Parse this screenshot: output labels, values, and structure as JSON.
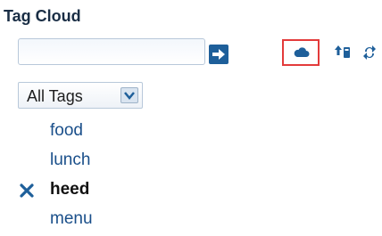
{
  "header": {
    "title": "Tag Cloud"
  },
  "search": {
    "value": "",
    "placeholder": ""
  },
  "toolbar": {
    "go_icon": "arrow-right-icon",
    "cloud_icon": "cloud-icon",
    "import_icon": "import-tags-icon",
    "sync_icon": "sync-icon",
    "highlight_color": "#e33b3b"
  },
  "filter": {
    "selected": "All Tags"
  },
  "tags": [
    {
      "label": "food",
      "selected": false
    },
    {
      "label": "lunch",
      "selected": false
    },
    {
      "label": "heed",
      "selected": true
    },
    {
      "label": "menu",
      "selected": false
    }
  ],
  "colors": {
    "tag_link": "#1a4f8a",
    "selected_tag": "#111111",
    "accent": "#1e5f9a"
  }
}
